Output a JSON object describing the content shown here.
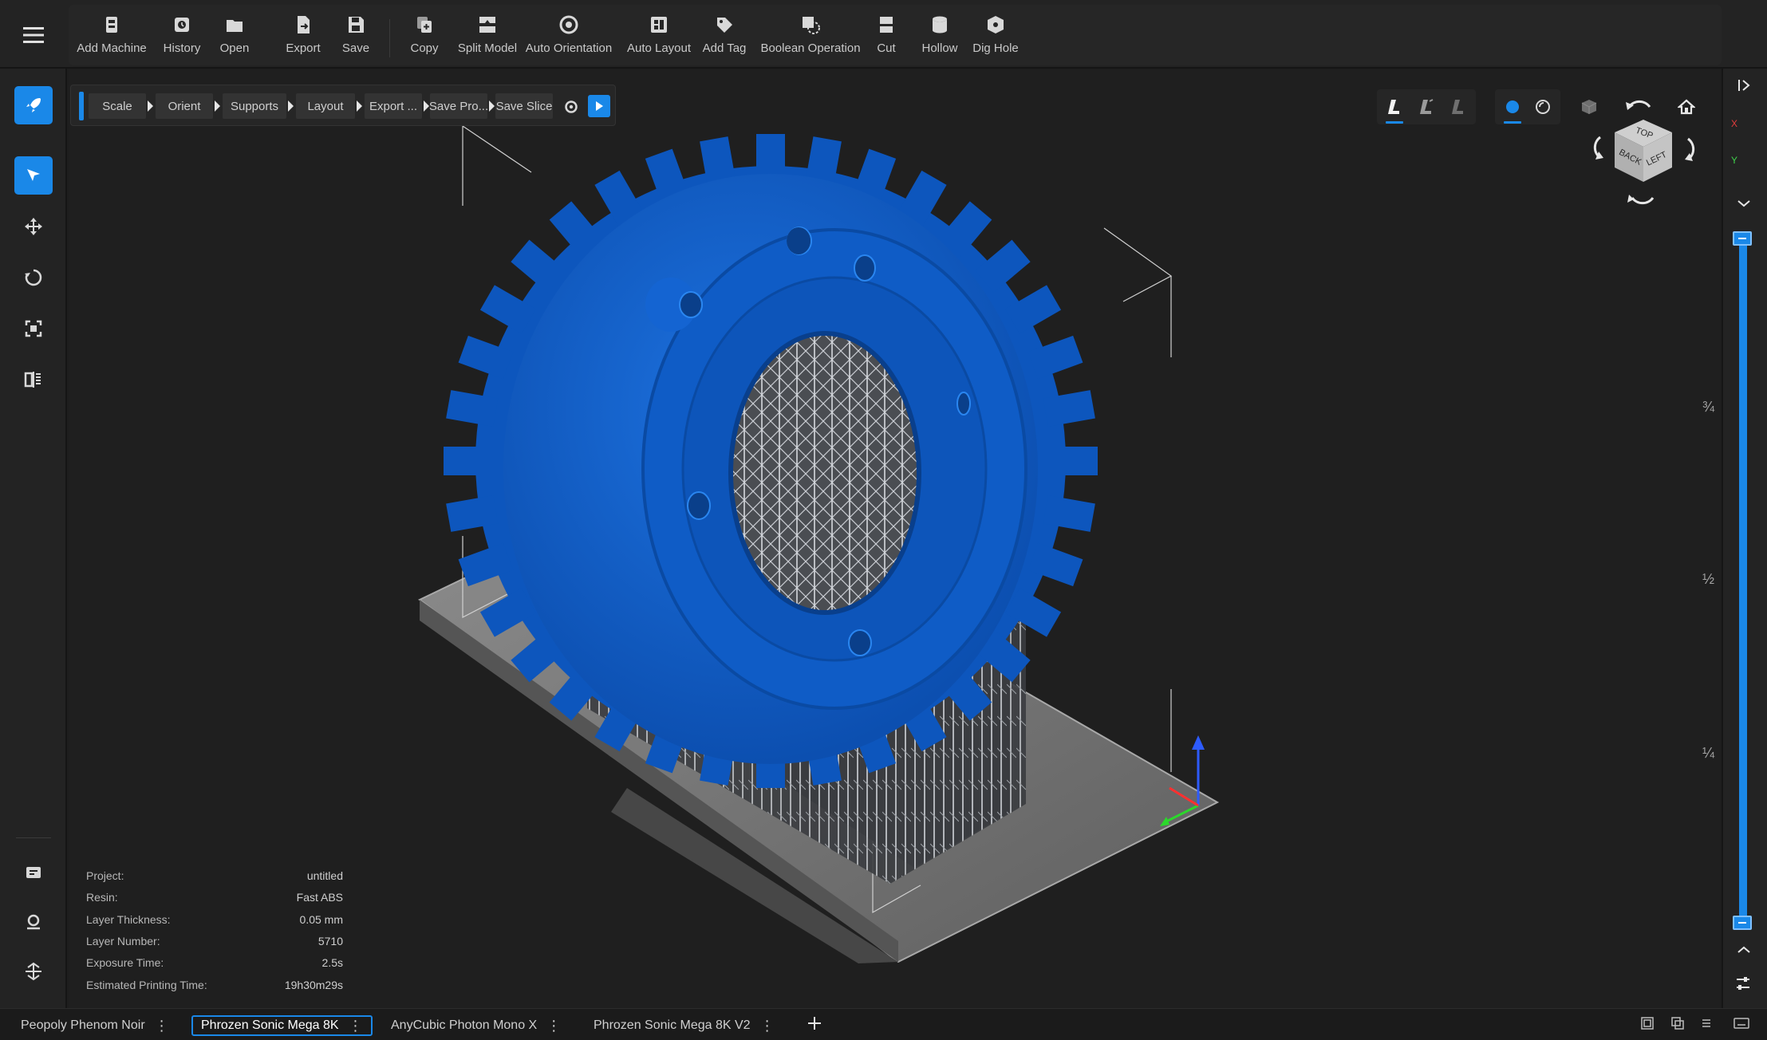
{
  "toolbar": {
    "menu_icon": "hamburger-menu-icon",
    "buttons": [
      {
        "label": "Add Machine",
        "icon": "add-machine-icon"
      },
      {
        "label": "History",
        "icon": "history-icon"
      },
      {
        "label": "Open",
        "icon": "folder-icon"
      },
      {
        "label": "Export",
        "icon": "export-icon"
      },
      {
        "label": "Save",
        "icon": "save-icon"
      },
      {
        "label": "Copy",
        "icon": "copy-icon"
      },
      {
        "label": "Split Model",
        "icon": "split-model-icon"
      },
      {
        "label": "Auto Orientation",
        "icon": "auto-orientation-icon"
      },
      {
        "label": "Auto Layout",
        "icon": "auto-layout-icon"
      },
      {
        "label": "Add Tag",
        "icon": "tag-icon"
      },
      {
        "label": "Boolean Operation",
        "icon": "boolean-operation-icon"
      },
      {
        "label": "Cut",
        "icon": "cut-icon"
      },
      {
        "label": "Hollow",
        "icon": "hollow-icon"
      },
      {
        "label": "Dig Hole",
        "icon": "dig-hole-icon"
      }
    ]
  },
  "workflow": {
    "steps": [
      "Scale",
      "Orient",
      "Supports",
      "Layout",
      "Export ...",
      "Save Pro...",
      "Save Slice"
    ]
  },
  "info": {
    "rows": [
      {
        "label": "Project:",
        "value": "untitled"
      },
      {
        "label": "Resin:",
        "value": "Fast ABS"
      },
      {
        "label": "Layer Thickness:",
        "value": "0.05 mm"
      },
      {
        "label": "Layer Number:",
        "value": "5710"
      },
      {
        "label": "Exposure Time:",
        "value": "2.5s"
      },
      {
        "label": "Estimated Printing Time:",
        "value": "19h30m29s"
      }
    ]
  },
  "navcube": {
    "top": "TOP",
    "back": "BACK",
    "left": "LEFT"
  },
  "axes": {
    "x": "X",
    "y": "Y"
  },
  "layer_slider": {
    "marks": [
      "¾",
      "½",
      "¼"
    ],
    "lower": 0,
    "upper": 1
  },
  "tabs": [
    {
      "label": "Peopoly Phenom Noir",
      "active": false
    },
    {
      "label": "Phrozen Sonic Mega 8K",
      "active": true
    },
    {
      "label": "AnyCubic Photon Mono X",
      "active": false
    },
    {
      "label": "Phrozen Sonic Mega 8K V2",
      "active": false
    }
  ],
  "colors": {
    "accent": "#1a88e8",
    "model": "#1160c8",
    "supports": "#c9ccd2",
    "plate": "#7a7a7a"
  }
}
